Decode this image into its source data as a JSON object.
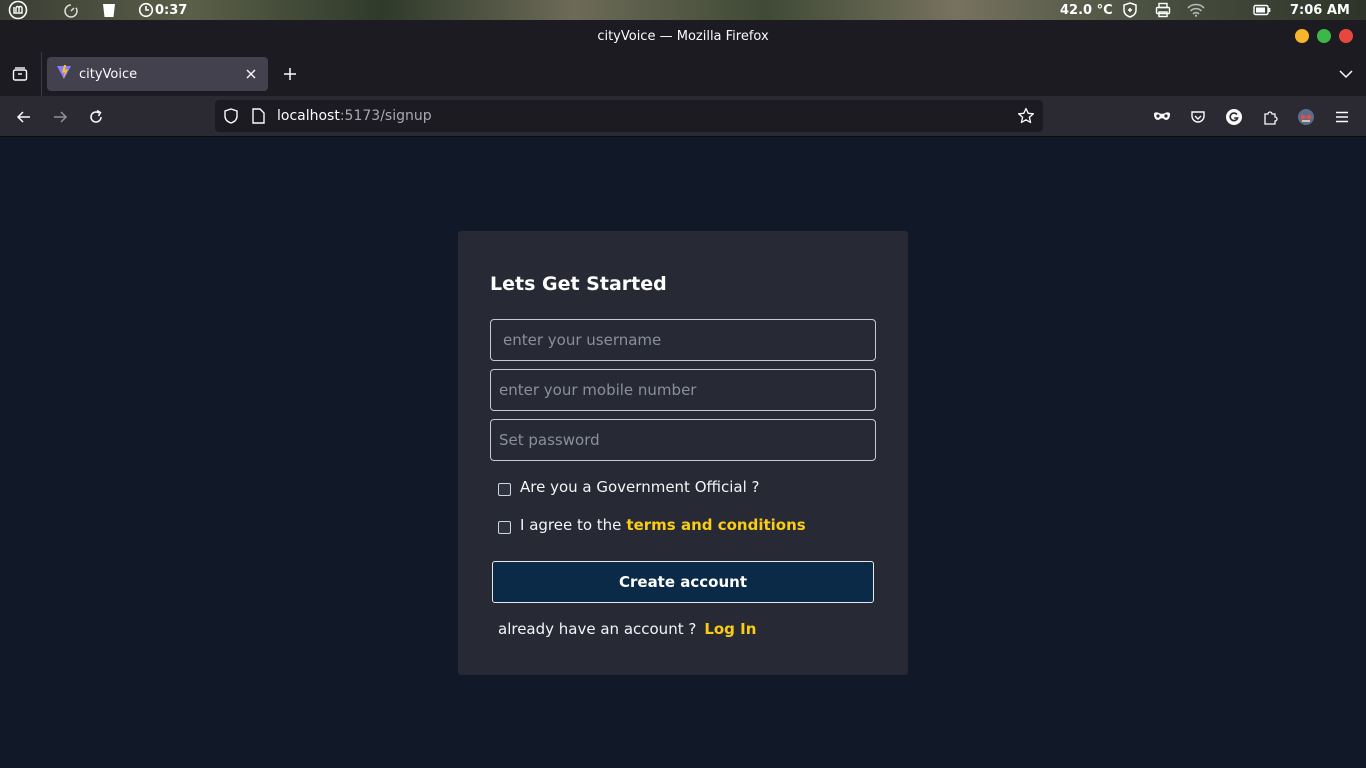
{
  "os_panel": {
    "timer": "0:37",
    "temperature": "42.0 °C",
    "clock": "7:06 AM",
    "icons": [
      "mint-menu-icon",
      "timer-icon",
      "trash-icon",
      "stopwatch-icon",
      "shield-icon",
      "printer-icon",
      "wifi-icon",
      "battery-icon"
    ]
  },
  "window": {
    "title": "cityVoice — Mozilla Firefox",
    "buttons": {
      "minimize_color": "#f6b52a",
      "maximize_color": "#3bb848",
      "close_color": "#e8473f"
    }
  },
  "tabs": [
    {
      "label": "cityVoice",
      "active": true
    }
  ],
  "navbar": {
    "url_host": "localhost",
    "url_path": ":5173/signup"
  },
  "signup": {
    "title": "Lets Get Started",
    "username_placeholder": "enter your username",
    "mobile_placeholder": "enter your mobile number",
    "password_placeholder": "Set password",
    "gov_official_label": "Are you a Government Official ?",
    "gov_official_checked": false,
    "agree_prefix": "I agree to the",
    "terms_link": "terms and conditions",
    "terms_checked": false,
    "create_button": "Create account",
    "have_account_text": "already have an account ?",
    "login_link": "Log In"
  },
  "colors": {
    "page_bg": "#111827",
    "card_bg": "#272a35",
    "accent_link": "#facc15",
    "primary_button": "#0b2a48"
  }
}
